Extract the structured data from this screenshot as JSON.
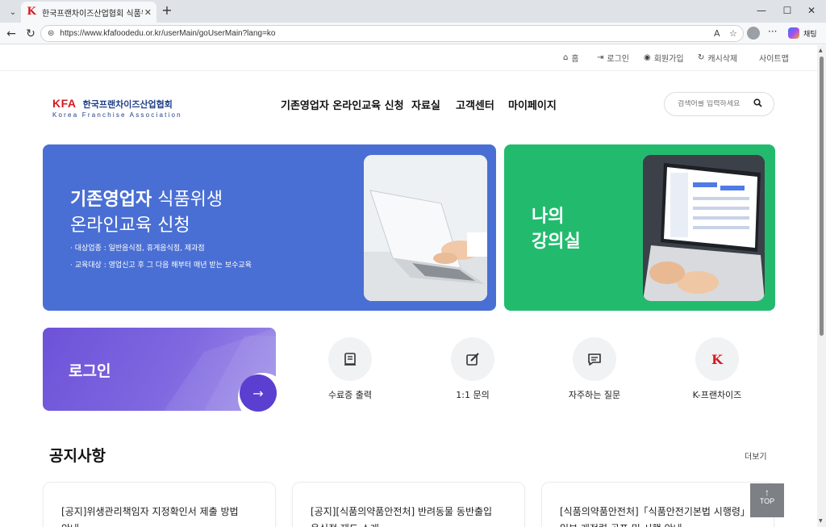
{
  "browser": {
    "tab_title": "한국프랜차이즈산업협회 식품위생",
    "favicon": "K",
    "url": "https://www.kfafoodedu.or.kr/userMain/goUserMain?lang=ko",
    "reader_mode": "A",
    "copilot_label": "채팅"
  },
  "util_nav": [
    {
      "icon": "home-icon",
      "glyph": "⌂",
      "label": "홈"
    },
    {
      "icon": "login-icon",
      "glyph": "⇥",
      "label": "로그인"
    },
    {
      "icon": "user-icon",
      "glyph": "◉",
      "label": "회원가입"
    },
    {
      "icon": "refresh-icon",
      "glyph": "↻",
      "label": "캐시삭제"
    },
    {
      "icon": "",
      "glyph": "",
      "label": "사이트맵"
    }
  ],
  "header": {
    "logo_mark": "KFA",
    "logo_kr": "한국프랜차이즈산업협회",
    "logo_en": "Korea Franchise Association",
    "menu": [
      "기존영업자 온라인교육 신청",
      "자료실",
      "고객센터",
      "마이페이지"
    ],
    "search_placeholder": "검색어를 입력하세요"
  },
  "banner_apply": {
    "title_bold": "기존영업자",
    "title_light": " 식품위생",
    "title_line2": "온라인교육 신청",
    "lines": [
      "· 대상업종 :  일반음식점, 휴게음식점, 제과점",
      "· 교육대상 :  영업신고 후 그 다음 해부터 매년 받는 보수교육"
    ]
  },
  "banner_lecture": {
    "line1": "나의",
    "line2": "강의실"
  },
  "login_card": {
    "title": "로그인",
    "arrow": "→"
  },
  "quick_links": [
    {
      "icon": "certificate-icon",
      "label": "수료증 출력"
    },
    {
      "icon": "edit-icon",
      "label": "1:1 문의"
    },
    {
      "icon": "chat-icon",
      "label": "자주하는 질문"
    },
    {
      "icon": "k-franchise-icon",
      "label": "K-프랜차이즈"
    }
  ],
  "notice": {
    "title": "공지사항",
    "more": "더보기",
    "items": [
      {
        "line1": "[공지]위생관리책임자 지정확인서 제출 방법",
        "line2": "안내"
      },
      {
        "line1": "[공지][식품의약품안전처] 반려동물 동반출입",
        "line2": "음식점 제도 소개"
      },
      {
        "line1": "[식품의약품안전처]「식품안전기본법 시행령」",
        "line2": "일부 개정령 공포 및 시행 안내"
      }
    ]
  },
  "top_button": {
    "arrow": "↑",
    "label": "TOP"
  },
  "colors": {
    "blue_banner": "#4a6fd4",
    "green_banner": "#22bb6e",
    "login_purple": "#6d52d8",
    "brand_red": "#d71920",
    "brand_navy": "#1f3f86"
  }
}
